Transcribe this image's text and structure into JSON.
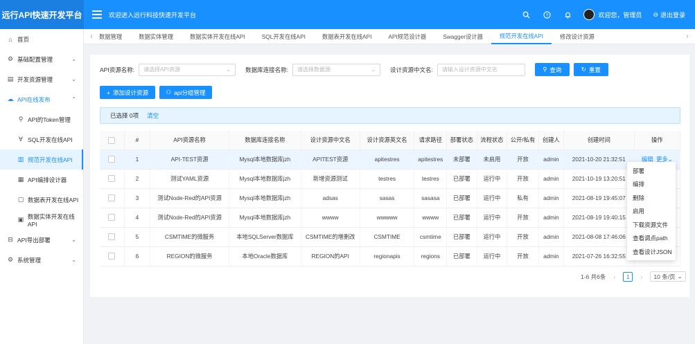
{
  "header": {
    "brand": "远行API快速开发平台",
    "welcome": "欢迎进入远行科技快速开发平台",
    "user_greeting": "欢迎您，管理员",
    "logout": "退出登录"
  },
  "sidebar": {
    "items": [
      {
        "label": "首页",
        "icon": "⌂"
      },
      {
        "label": "基础配置管理",
        "icon": "⚙",
        "arrow": "⌄"
      },
      {
        "label": "开发资源管理",
        "icon": "▤",
        "arrow": "⌄"
      },
      {
        "label": "API在线发布",
        "icon": "☁",
        "arrow": "⌃"
      },
      {
        "label": "API的Token管理",
        "icon": "⚲"
      },
      {
        "label": "SQL开发在线API",
        "icon": "∀"
      },
      {
        "label": "规范开发在线API",
        "icon": "▥"
      },
      {
        "label": "API编排设计器",
        "icon": "▦"
      },
      {
        "label": "数据表开发在线API",
        "icon": "▢"
      },
      {
        "label": "数据实体开发在线API",
        "icon": "▣"
      },
      {
        "label": "API导出部署",
        "icon": "⊟",
        "arrow": "⌄"
      },
      {
        "label": "系统管理",
        "icon": "⚙",
        "arrow": "⌄"
      }
    ]
  },
  "tabs": [
    "数据管理",
    "数据实体管理",
    "数据实体开发在线API",
    "SQL开发在线API",
    "数据表开发在线API",
    "API规范设计器",
    "Swagger设计器",
    "规范开发在线API",
    "修改设计资源"
  ],
  "filters": {
    "api_name_label": "API资源名称:",
    "api_name_placeholder": "请选择API资源",
    "db_label": "数据库连接名称:",
    "db_placeholder": "请选择数据源",
    "cn_name_label": "设计资源中文名:",
    "cn_name_placeholder": "请输入设计资源中文名",
    "query": "查询",
    "reset": "重置"
  },
  "actions": {
    "add": "添加设计资源",
    "group": "api分组管理"
  },
  "alert": {
    "selected": "已选择 0项",
    "clear": "清空"
  },
  "table": {
    "columns": [
      "#",
      "API资源名称",
      "数据库连接名称",
      "设计资源中文名",
      "设计资源英文名",
      "请求路径",
      "部署状态",
      "流程状态",
      "公开/私有",
      "创建人",
      "创建时间",
      "操作"
    ],
    "rows": [
      {
        "n": "1",
        "name": "API-TEST资源",
        "db": "Mysql本地数据库jzh",
        "cn": "APITEST资源",
        "en": "apitestres",
        "path": "apitestres",
        "deploy": "未部署",
        "flow": "未启用",
        "pub": "开放",
        "user": "admin",
        "time": "2021-10-20 21:32:51"
      },
      {
        "n": "2",
        "name": "测试YAML资源",
        "db": "Mysql本地数据库jzh",
        "cn": "新增资源测试",
        "en": "testres",
        "path": "testres",
        "deploy": "已部署",
        "flow": "运行中",
        "pub": "开放",
        "user": "admin",
        "time": "2021-10-19 13:20:51"
      },
      {
        "n": "3",
        "name": "测试Node-Red的API资源",
        "db": "Mysql本地数据库jzh",
        "cn": "adsas",
        "en": "sasas",
        "path": "sasasa",
        "deploy": "已部署",
        "flow": "运行中",
        "pub": "私有",
        "user": "admin",
        "time": "2021-08-19 19:45:07"
      },
      {
        "n": "4",
        "name": "测试Node-Red的API资源",
        "db": "Mysql本地数据库jzh",
        "cn": "wwww",
        "en": "wwwww",
        "path": "wwww",
        "deploy": "已部署",
        "flow": "运行中",
        "pub": "开放",
        "user": "admin",
        "time": "2021-08-19 19:40:15"
      },
      {
        "n": "5",
        "name": "CSMTIME的微服务",
        "db": "本地SQLServer数据库",
        "cn": "CSMTIME的增删改",
        "en": "CSMTIME",
        "path": "csmtime",
        "deploy": "已部署",
        "flow": "运行中",
        "pub": "开放",
        "user": "admin",
        "time": "2021-08-08 17:46:06"
      },
      {
        "n": "6",
        "name": "REGION的微服务",
        "db": "本地Oracle数据库",
        "cn": "REGION的API",
        "en": "regionapis",
        "path": "regions",
        "deploy": "已部署",
        "flow": "运行中",
        "pub": "开放",
        "user": "admin",
        "time": "2021-07-26 16:32:55"
      }
    ],
    "row_actions": {
      "edit": "编辑",
      "more": "更多"
    }
  },
  "dropdown": [
    "部署",
    "编排",
    "删除",
    "启用",
    "下载资源文件",
    "查看调点path",
    "查看设计JSON"
  ],
  "pagination": {
    "summary": "1-6 共6条",
    "current": "1",
    "page_size": "10 条/页"
  },
  "colors": {
    "primary": "#1890ff",
    "danger": "#ff4d4f",
    "success": "#52c41a"
  }
}
